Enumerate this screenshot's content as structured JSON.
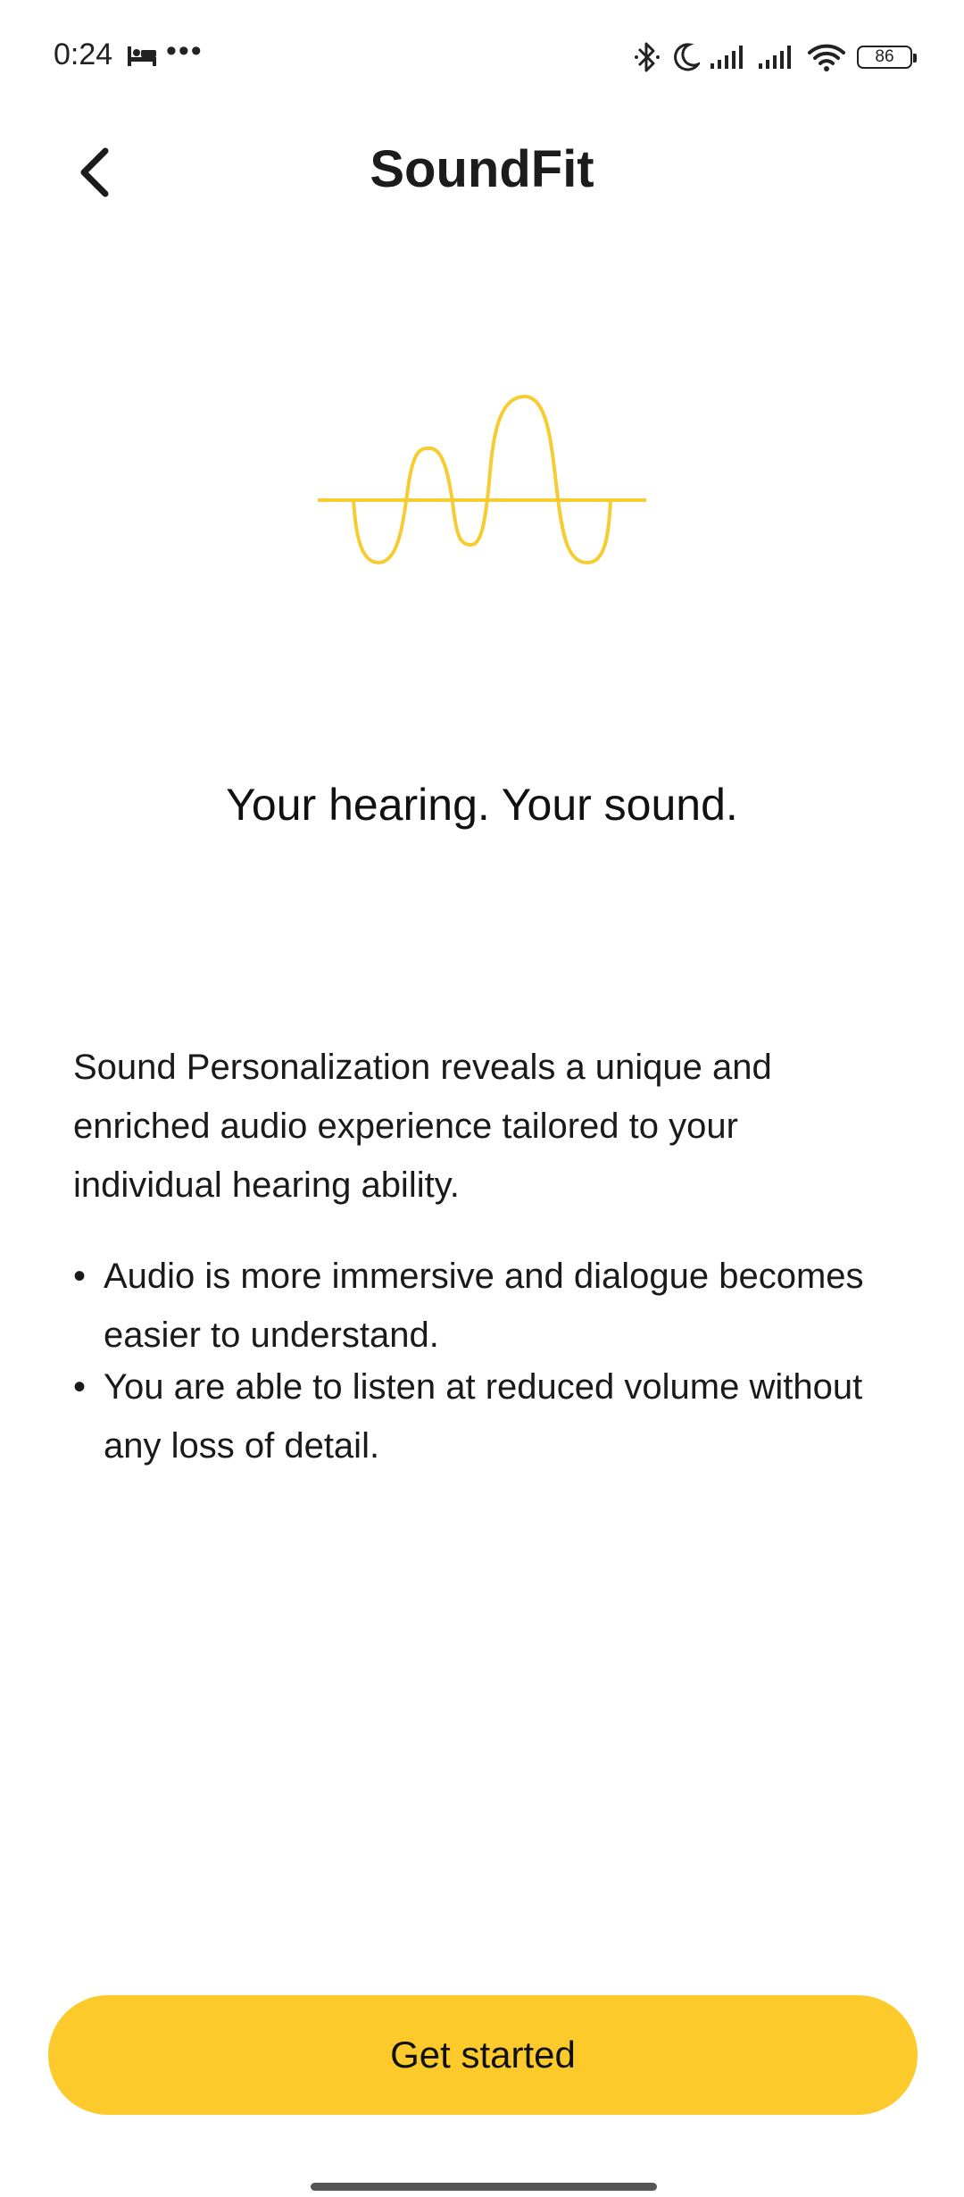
{
  "status_bar": {
    "time": "0:24",
    "more": "•••",
    "battery_level": "86",
    "icons": [
      "bed-icon",
      "bluetooth-icon",
      "moon-icon",
      "signal-icon",
      "signal-icon",
      "wifi-icon",
      "battery-icon"
    ]
  },
  "header": {
    "title": "SoundFit",
    "back_icon": "chevron-left-icon"
  },
  "illustration": {
    "icon": "sound-wave-icon",
    "color": "#f7cc33"
  },
  "headline": "Your hearing. Your sound.",
  "body": {
    "intro": "Sound Personalization reveals a unique and enriched audio experience tailored to your individual hearing ability.",
    "bullets": [
      "Audio is more immersive and dialogue becomes easier to understand.",
      "You are able to listen at reduced volume without any loss of detail."
    ],
    "bullet_symbol": "•"
  },
  "cta": {
    "label": "Get started",
    "color": "#fccb2b"
  }
}
